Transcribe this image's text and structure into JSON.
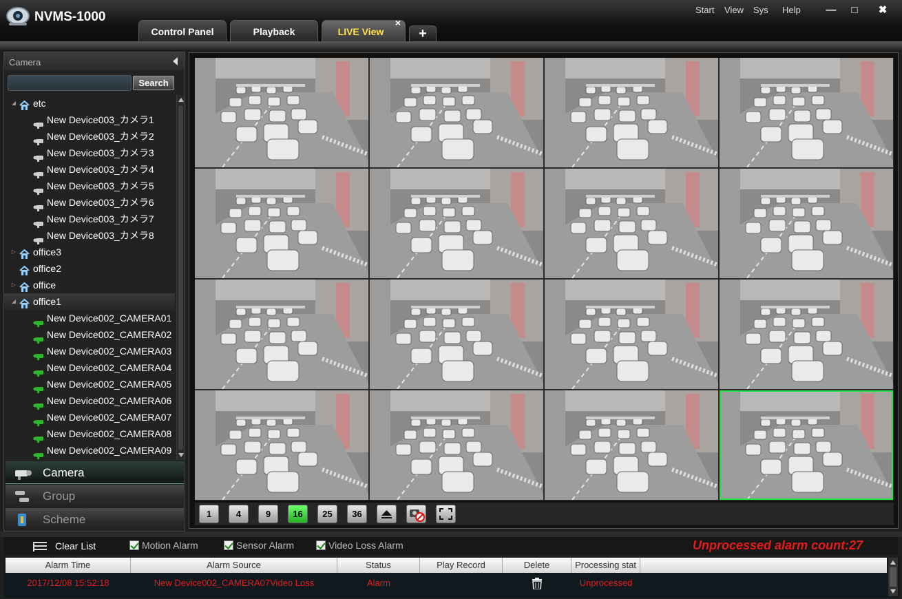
{
  "window": {
    "title": "NVMS-1000",
    "menu": [
      "Start",
      "View",
      "Sys",
      "Help"
    ],
    "controls": {
      "minimize": "—",
      "maximize": "□",
      "close": "✖"
    }
  },
  "tabs": [
    {
      "label": "Control Panel",
      "active": false
    },
    {
      "label": "Playback",
      "active": false
    },
    {
      "label": "LIVE View",
      "active": true,
      "close": "×"
    }
  ],
  "add_tab_label": "+",
  "camera_panel": {
    "header": "Camera",
    "search_placeholder": "",
    "search_button": "Search",
    "tree": [
      {
        "type": "group",
        "label": "etc",
        "expanded": true
      },
      {
        "type": "camera",
        "label": "New  Device003_カメラ1",
        "online": false
      },
      {
        "type": "camera",
        "label": "New  Device003_カメラ2",
        "online": false
      },
      {
        "type": "camera",
        "label": "New  Device003_カメラ3",
        "online": false
      },
      {
        "type": "camera",
        "label": "New  Device003_カメラ4",
        "online": false
      },
      {
        "type": "camera",
        "label": "New  Device003_カメラ5",
        "online": false
      },
      {
        "type": "camera",
        "label": "New  Device003_カメラ6",
        "online": false
      },
      {
        "type": "camera",
        "label": "New  Device003_カメラ7",
        "online": false
      },
      {
        "type": "camera",
        "label": "New  Device003_カメラ8",
        "online": false
      },
      {
        "type": "group",
        "label": "office3",
        "expanded": false
      },
      {
        "type": "group",
        "label": "office2",
        "expanded": null
      },
      {
        "type": "group",
        "label": "office",
        "expanded": false
      },
      {
        "type": "group",
        "label": "office1",
        "expanded": true,
        "selected": true
      },
      {
        "type": "camera",
        "label": "New Device002_CAMERA01",
        "online": true
      },
      {
        "type": "camera",
        "label": "New Device002_CAMERA02",
        "online": true
      },
      {
        "type": "camera",
        "label": "New Device002_CAMERA03",
        "online": true
      },
      {
        "type": "camera",
        "label": "New Device002_CAMERA04",
        "online": true
      },
      {
        "type": "camera",
        "label": "New Device002_CAMERA05",
        "online": true
      },
      {
        "type": "camera",
        "label": "New Device002_CAMERA06",
        "online": true
      },
      {
        "type": "camera",
        "label": "New Device002_CAMERA07",
        "online": true
      },
      {
        "type": "camera",
        "label": "New Device002_CAMERA08",
        "online": true
      },
      {
        "type": "camera",
        "label": "New Device002_CAMERA09",
        "online": true
      }
    ],
    "nav": [
      {
        "label": "Camera",
        "icon": "camera-icon",
        "active": true
      },
      {
        "label": "Group",
        "icon": "group-icon",
        "active": false
      },
      {
        "label": "Scheme",
        "icon": "scheme-icon",
        "active": false
      }
    ]
  },
  "live_view": {
    "tile_count": 16,
    "selected_tile": 15,
    "layout_buttons": [
      {
        "label": "1",
        "icon": "layout-1-icon",
        "active": false
      },
      {
        "label": "4",
        "icon": "layout-4-icon",
        "active": false
      },
      {
        "label": "9",
        "icon": "layout-9-icon",
        "active": false
      },
      {
        "label": "16",
        "icon": "layout-16-icon",
        "active": true
      },
      {
        "label": "25",
        "icon": "layout-25-icon",
        "active": false
      },
      {
        "label": "36",
        "icon": "layout-36-icon",
        "active": false
      },
      {
        "label": "",
        "icon": "eject-icon",
        "active": false
      },
      {
        "label": "",
        "icon": "stop-all-icon",
        "active": false
      },
      {
        "label": "",
        "icon": "fullscreen-icon",
        "active": false
      }
    ]
  },
  "alarm_bar": {
    "clear_list": "Clear List",
    "checkboxes": [
      {
        "label": "Motion Alarm",
        "checked": true
      },
      {
        "label": "Sensor Alarm",
        "checked": true
      },
      {
        "label": "Video Loss Alarm",
        "checked": true
      }
    ],
    "unprocessed_count_text": "Unprocessed alarm count:27"
  },
  "alarm_table": {
    "columns": [
      "Alarm Time",
      "Alarm Source",
      "Status",
      "Play Record",
      "Delete",
      "Processing stat"
    ],
    "rows": [
      {
        "time": "2017/12/08 15:52:18",
        "source": "New Device002_CAMERA07Video Loss",
        "status": "Alarm",
        "play_record": "",
        "processing": "Unprocessed"
      }
    ]
  },
  "colors": {
    "accent_active_tab": "#ffe44a",
    "selected_tile": "#27e23a",
    "alarm_text": "#e41e1e",
    "online_camera": "#2fb52f",
    "offline_camera": "#cfcfcf"
  }
}
